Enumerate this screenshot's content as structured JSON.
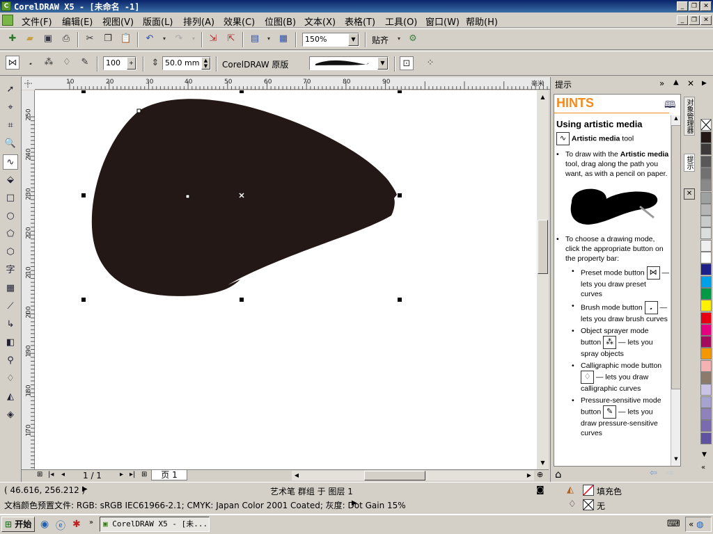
{
  "window": {
    "title": "CorelDRAW X5 - [未命名 -1]",
    "app_icon": "coreldraw-icon"
  },
  "menu": [
    "文件(F)",
    "编辑(E)",
    "视图(V)",
    "版面(L)",
    "排列(A)",
    "效果(C)",
    "位图(B)",
    "文本(X)",
    "表格(T)",
    "工具(O)",
    "窗口(W)",
    "帮助(H)"
  ],
  "standard_toolbar": {
    "zoom_level": "150%",
    "snap_label": "贴齐"
  },
  "property_bar": {
    "smoothing_value": "100",
    "width_value": "50.0 mm",
    "preset_name": "CorelDRAW 原版"
  },
  "rulers": {
    "horizontal_unit": "毫米",
    "horizontal_ticks": [
      "10",
      "20",
      "30",
      "40",
      "50",
      "60",
      "70",
      "80",
      "90"
    ],
    "vertical_ticks": [
      "250",
      "240",
      "230",
      "220",
      "210",
      "200",
      "190",
      "180",
      "170"
    ]
  },
  "page_nav": {
    "page_count": "1 / 1",
    "page_tab": "页 1"
  },
  "docker": {
    "header": "提示",
    "brand": "HINTS",
    "heading": "Using artistic media",
    "tool_label_bold": "Artistic media",
    "tool_label_rest": "tool",
    "intro_pre": "To draw with the ",
    "intro_bold": "Artistic media",
    "intro_post": " tool, drag along the path you want, as with a pencil on paper.",
    "mode_intro": "To choose a drawing mode, click the appropriate button on the property bar:",
    "modes": [
      {
        "name": "Preset mode button",
        "desc": "— lets you draw preset curves"
      },
      {
        "name": "Brush mode button",
        "desc": "— lets you draw brush curves"
      },
      {
        "name": "Object sprayer mode button",
        "desc": "— lets you spray objects"
      },
      {
        "name": "Calligraphic mode button",
        "desc": "— lets you draw calligraphic curves"
      },
      {
        "name": "Pressure-sensitive mode button",
        "desc": "— lets you draw pressure-sensitive curves"
      }
    ],
    "side_tab_1": "对象管理器",
    "side_tab_2": "提示"
  },
  "palette_colors": [
    "#231815",
    "#3e3a39",
    "#595757",
    "#727171",
    "#898989",
    "#9fa0a0",
    "#b5b5b6",
    "#c9caca",
    "#dcdddd",
    "#efefef",
    "#ffffff",
    "#1d2088",
    "#00a0e9",
    "#009944",
    "#fff100",
    "#e60012",
    "#e4007f",
    "#a40b5d",
    "#f39800",
    "#f5b2b2",
    "#8c7b6b",
    "#c9c3e6",
    "#a6a3d0",
    "#8f82bc",
    "#7a6ab0",
    "#5f52a0"
  ],
  "status": {
    "coordinates": "( 46.616, 256.212 )",
    "object_info": "艺术笔 群组 于 图层 1",
    "color_profile": "文档颜色预置文件: RGB: sRGB IEC61966-2.1; CMYK: Japan Color 2001 Coated; 灰度: Dot Gain 15%",
    "fill_label": "填充色",
    "outline_label": "无"
  },
  "taskbar": {
    "start": "开始",
    "task": "CorelDRAW X5 - [未..."
  }
}
